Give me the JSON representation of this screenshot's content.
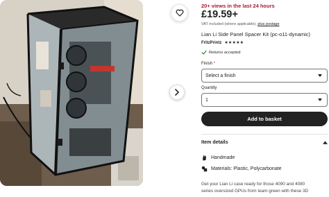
{
  "product": {
    "views": "20+ views in the last 24 hours",
    "price": "£19.59+",
    "vat_text": "VAT included (where applicable),",
    "vat_link": "plus postage",
    "title": "Lian Li Side Panel Spacer Kit (pc-o11-dynamic)",
    "shop_name": "FritzPrintz",
    "stars": "★★★★★",
    "returns": "Returns accepted"
  },
  "finish": {
    "label": "Finish",
    "required_mark": "*",
    "selected": "Select a finish"
  },
  "quantity": {
    "label": "Quantity",
    "selected": "1"
  },
  "basket_label": "Add to basket",
  "details": {
    "title": "Item details",
    "handmade": "Handmade",
    "materials": "Materials: Plastic, Polycarbonate"
  },
  "description": {
    "line1": "Get your Lian Li case ready for those 4090 and 4080",
    "line2": "series oversized GPUs from team green with these 3D"
  },
  "icons": {
    "favorite": "heart-icon",
    "next": "chevron-right-icon",
    "returns": "check-icon",
    "select": "chevron-down-icon",
    "details": "chevron-up-icon",
    "handmade": "hand-icon",
    "materials": "materials-icon"
  },
  "colors": {
    "views_red": "#a61a2e",
    "button_dark": "#222222",
    "required_red": "#a61a2e"
  }
}
